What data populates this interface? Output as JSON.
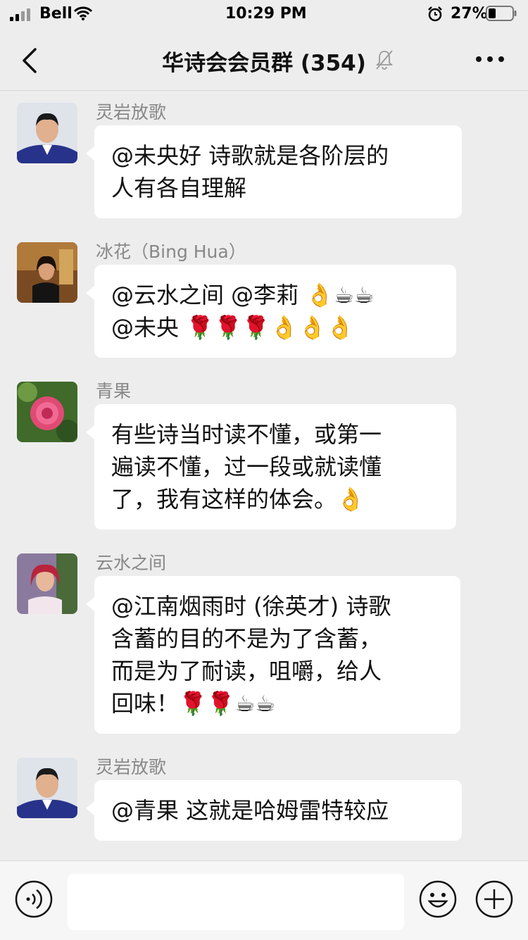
{
  "status": {
    "carrier": "Bell",
    "time": "10:29 PM",
    "battery": "27%"
  },
  "nav": {
    "title": "华诗会会员群 (354)"
  },
  "messages": [
    {
      "sender": "灵岩放歌",
      "lines": [
        "@未央好 诗歌就是各阶层的",
        "人有各自理解"
      ]
    },
    {
      "sender": "冰花（Bing Hua）",
      "lines": [
        "@云水之间 @李莉 👌☕☕",
        "@未央 🌹🌹🌹👌👌👌"
      ]
    },
    {
      "sender": "青果",
      "lines": [
        "有些诗当时读不懂，或第一",
        "遍读不懂，过一段或就读懂",
        "了，我有这样的体会。👌"
      ]
    },
    {
      "sender": "云水之间",
      "lines": [
        "@江南烟雨时 (徐英才) 诗歌",
        "含蓄的目的不是为了含蓄，",
        "而是为了耐读，咀嚼，给人",
        "回味！🌹🌹☕☕"
      ]
    },
    {
      "sender": "灵岩放歌",
      "lines": [
        "@青果 这就是哈姆雷特较应"
      ]
    }
  ],
  "colors": {
    "background": "#ededed",
    "bubble": "#ffffff",
    "sender": "#888888"
  }
}
